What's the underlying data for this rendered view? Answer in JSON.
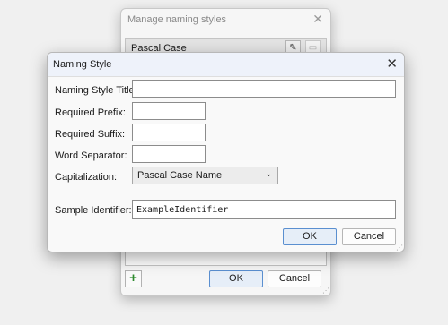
{
  "background_dialog": {
    "title": "Manage naming styles",
    "list_items": [
      "Pascal Case"
    ],
    "ok_label": "OK",
    "cancel_label": "Cancel"
  },
  "naming_style_dialog": {
    "title": "Naming Style",
    "fields": {
      "title": {
        "label": "Naming Style Title:",
        "value": ""
      },
      "prefix": {
        "label": "Required Prefix:",
        "value": ""
      },
      "suffix": {
        "label": "Required Suffix:",
        "value": ""
      },
      "separator": {
        "label": "Word Separator:",
        "value": ""
      }
    },
    "capitalization": {
      "label": "Capitalization:",
      "selected": "Pascal Case Name"
    },
    "sample": {
      "label": "Sample Identifier:",
      "value": "ExampleIdentifier"
    },
    "ok_label": "OK",
    "cancel_label": "Cancel"
  },
  "icons": {
    "close": "close-icon",
    "edit": "pencil-icon",
    "remove": "remove-icon",
    "add": "plus-icon",
    "dropdown": "chevron-down-icon",
    "grip": "resize-grip-icon"
  },
  "colors": {
    "add_icon": "#2e8b2e",
    "primary_button_border": "#5a8fd0",
    "title_bar": "#eef2fa"
  }
}
